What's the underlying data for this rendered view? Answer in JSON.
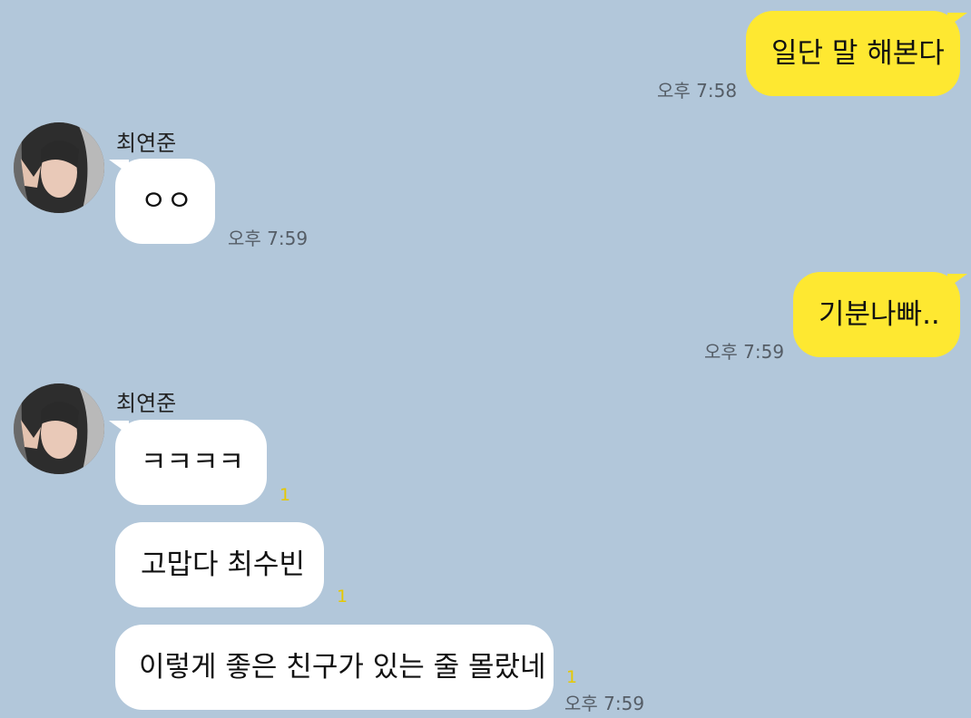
{
  "messages": {
    "m1": {
      "text": "일단 말 해본다",
      "time": "오후 7:58"
    },
    "m2": {
      "sender": "최연준",
      "text": "ㅇㅇ",
      "time": "오후 7:59"
    },
    "m3": {
      "text": "기분나빠..",
      "time": "오후 7:59"
    },
    "m4": {
      "sender": "최연준",
      "text": "ㅋㅋㅋㅋ",
      "unread": "1"
    },
    "m5": {
      "text": "고맙다 최수빈",
      "unread": "1"
    },
    "m6": {
      "text": "이렇게 좋은 친구가 있는 줄 몰랐네",
      "unread": "1",
      "time": "오후 7:59"
    }
  },
  "colors": {
    "background": "#b2c7da",
    "my_bubble": "#fee831",
    "their_bubble": "#ffffff",
    "unread": "#e6c800"
  },
  "icons": {
    "avatar": "profile-photo"
  }
}
